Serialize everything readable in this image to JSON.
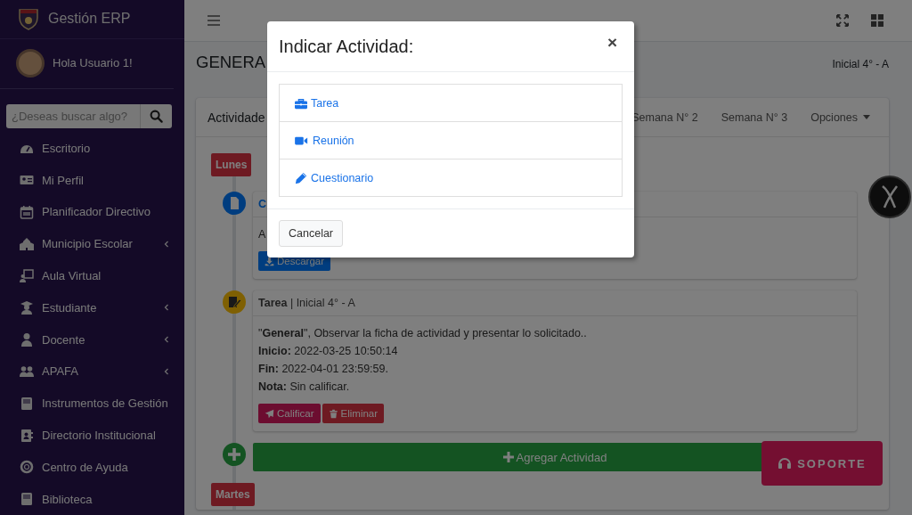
{
  "sidebar": {
    "brand": "Gestión ERP",
    "user": "Hola Usuario 1!",
    "search": {
      "placeholder": "¿Deseas buscar algo?"
    },
    "items": [
      {
        "label": "Escritorio",
        "has_submenu": false
      },
      {
        "label": "Mi Perfil",
        "has_submenu": false
      },
      {
        "label": "Planificador Directivo",
        "has_submenu": false
      },
      {
        "label": "Municipio Escolar",
        "has_submenu": true
      },
      {
        "label": "Aula Virtual",
        "has_submenu": false
      },
      {
        "label": "Estudiante",
        "has_submenu": true
      },
      {
        "label": "Docente",
        "has_submenu": true
      },
      {
        "label": "APAFA",
        "has_submenu": true
      },
      {
        "label": "Instrumentos de Gestión",
        "has_submenu": false
      },
      {
        "label": "Directorio Institucional",
        "has_submenu": false
      },
      {
        "label": "Centro de Ayuda",
        "has_submenu": false
      },
      {
        "label": "Biblioteca",
        "has_submenu": false
      }
    ]
  },
  "page": {
    "title": "GENERA",
    "class_label": "Inicial 4° - A"
  },
  "card": {
    "title": "Actividade",
    "tabs": [
      {
        "label": "Semana N° 2",
        "selected": false
      },
      {
        "label": "Semana N° 3",
        "selected": false
      }
    ],
    "options_menu": "Opciones"
  },
  "timeline": [
    {
      "kind": "day",
      "label": "Lunes"
    },
    {
      "kind": "file",
      "title": "C",
      "title_link": true,
      "body_lines": [
        "A"
      ],
      "buttons": [
        {
          "label": "Descargar",
          "kind": "download"
        }
      ]
    },
    {
      "kind": "task",
      "title": "**Tarea** | Inicial 4° - A",
      "title_link": false,
      "body_lines": [
        "\"**General**\", Observar la ficha de actividad y presentar lo solicitado..",
        "**Inicio:** 2022-03-25 10:50:14",
        "**Fin:** 2022-04-01 23:59:59.",
        "**Nota:** Sin calificar."
      ],
      "buttons": [
        {
          "label": "Calificar",
          "kind": "grade"
        },
        {
          "label": "Eliminar",
          "kind": "delete"
        }
      ]
    },
    {
      "kind": "add",
      "label": "Agregar Actividad"
    },
    {
      "kind": "day",
      "label": "Martes"
    }
  ],
  "support_button": "SOPORTE",
  "modal": {
    "title": "Indicar Actividad:",
    "close": "×",
    "options": [
      {
        "label": "Tarea"
      },
      {
        "label": "Reunión"
      },
      {
        "label": "Cuestionario"
      }
    ],
    "cancel": "Cancelar"
  }
}
